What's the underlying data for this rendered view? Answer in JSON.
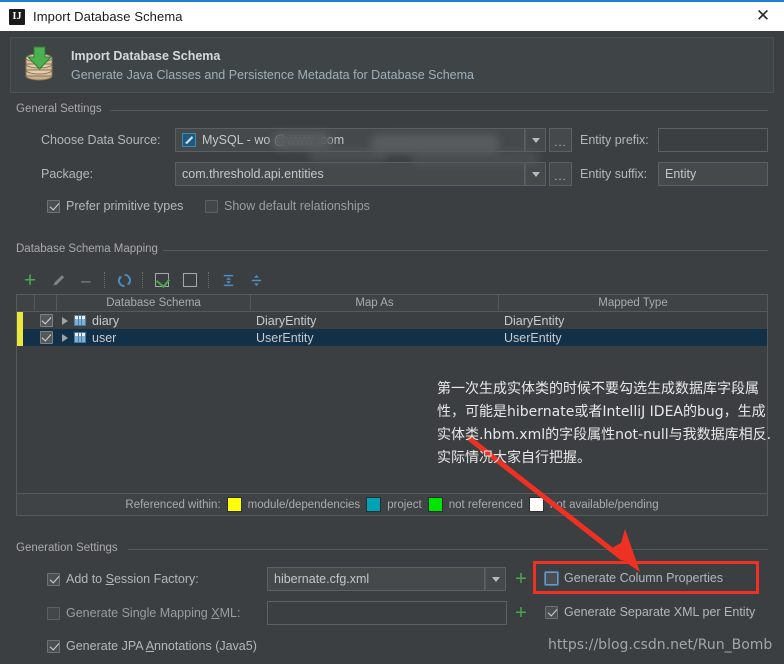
{
  "window": {
    "title": "Import Database Schema",
    "icon": "intellij-idea-icon",
    "close_label": "✕"
  },
  "banner": {
    "icon": "database-import-icon",
    "title": "Import Database Schema",
    "subtitle": "Generate Java Classes and Persistence Metadata for Database Schema"
  },
  "general_settings": {
    "group_label": "General Settings",
    "data_source": {
      "label": "Choose Data Source:",
      "value": "MySQL - wo            @www                   .com",
      "icon": "mysql-datasource-icon",
      "dots_label": "..."
    },
    "package": {
      "label": "Package:",
      "value": "com.threshold.api.entities",
      "dots_label": "..."
    },
    "entity_prefix": {
      "label": "Entity prefix:",
      "value": "",
      "placeholder": ""
    },
    "entity_suffix": {
      "label": "Entity suffix:",
      "value": "Entity"
    },
    "prefer_primitive": {
      "label": "Prefer primitive types",
      "checked": true
    },
    "show_default_rel": {
      "label": "Show default relationships",
      "checked": false
    }
  },
  "schema_mapping": {
    "group_label": "Database Schema Mapping",
    "toolbar": [
      {
        "name": "add-button",
        "glyph": "+",
        "color": "#4aa84a"
      },
      {
        "name": "edit-button",
        "glyph": "pencil",
        "color": "#8b8f91"
      },
      {
        "name": "remove-button",
        "glyph": "–",
        "color": "#8b8f91"
      },
      {
        "name": "refresh-button",
        "glyph": "refresh",
        "color": "#4a90c4"
      },
      {
        "name": "select-all-button",
        "glyph": "checked-box",
        "color": "#4aa84a"
      },
      {
        "name": "deselect-all-button",
        "glyph": "empty-box",
        "color": "#9a9d9f"
      },
      {
        "name": "expand-all-button",
        "glyph": "expand",
        "color": "#4a90c4"
      },
      {
        "name": "collapse-all-button",
        "glyph": "collapse",
        "color": "#4a90c4"
      }
    ],
    "columns": [
      "",
      "",
      "Database Schema",
      "Map As",
      "Mapped Type"
    ],
    "rows": [
      {
        "checked": true,
        "marker_color": "#ebe83a",
        "name": "diary",
        "map_as": "DiaryEntity",
        "mapped_type": "DiaryEntity",
        "selected": false
      },
      {
        "checked": true,
        "marker_color": "#ebe83a",
        "name": "user",
        "map_as": "UserEntity",
        "mapped_type": "UserEntity",
        "selected": true
      }
    ],
    "legend": {
      "title": "Referenced within:",
      "items": [
        {
          "label": "module/dependencies",
          "color": "#ffff00"
        },
        {
          "label": "project",
          "color": "#00a2b5"
        },
        {
          "label": "not referenced",
          "color": "#00e500"
        },
        {
          "label": "not available/pending",
          "color": "#ffffff"
        }
      ]
    }
  },
  "generation_settings": {
    "group_label": "Generation Settings",
    "add_to_session_factory": {
      "label": "Add to ",
      "mnemonic": "S",
      "label_rest": "ession Factory:",
      "checked": true,
      "value": "hibernate.cfg.xml"
    },
    "generate_single_mapping_xml": {
      "label": "Generate Single Mapping ",
      "mnemonic": "X",
      "label_rest": "ML:",
      "checked": false,
      "value": ""
    },
    "generate_jpa_annotations": {
      "label": "Generate JPA ",
      "mnemonic": "A",
      "label_rest": "nnotations (Java5)",
      "checked": true
    },
    "generate_column_properties": {
      "label": "Generate Column Properties",
      "checked": false,
      "highlighted": true
    },
    "generate_separate_xml": {
      "label": "Generate Separate XML per Entity",
      "checked": true
    },
    "plus_label": "+"
  },
  "annotation": {
    "text": "第一次生成实体类的时候不要勾选生成数据库字段属性，可能是hibernate或者IntelliJ IDEA的bug，生成实体类.hbm.xml的字段属性not-null与我数据库相反.实际情况大家自行把握。",
    "arrow_color": "#ef3124",
    "box_color": "#ef3124"
  },
  "watermark": {
    "text": "https://blog.csdn.net/Run_Bomb"
  },
  "colors": {
    "background": "#3c3f41",
    "accent_blue": "#1f7fd1",
    "selection": "#123048",
    "marker_yellow": "#ebe83a",
    "red": "#ef3124"
  }
}
